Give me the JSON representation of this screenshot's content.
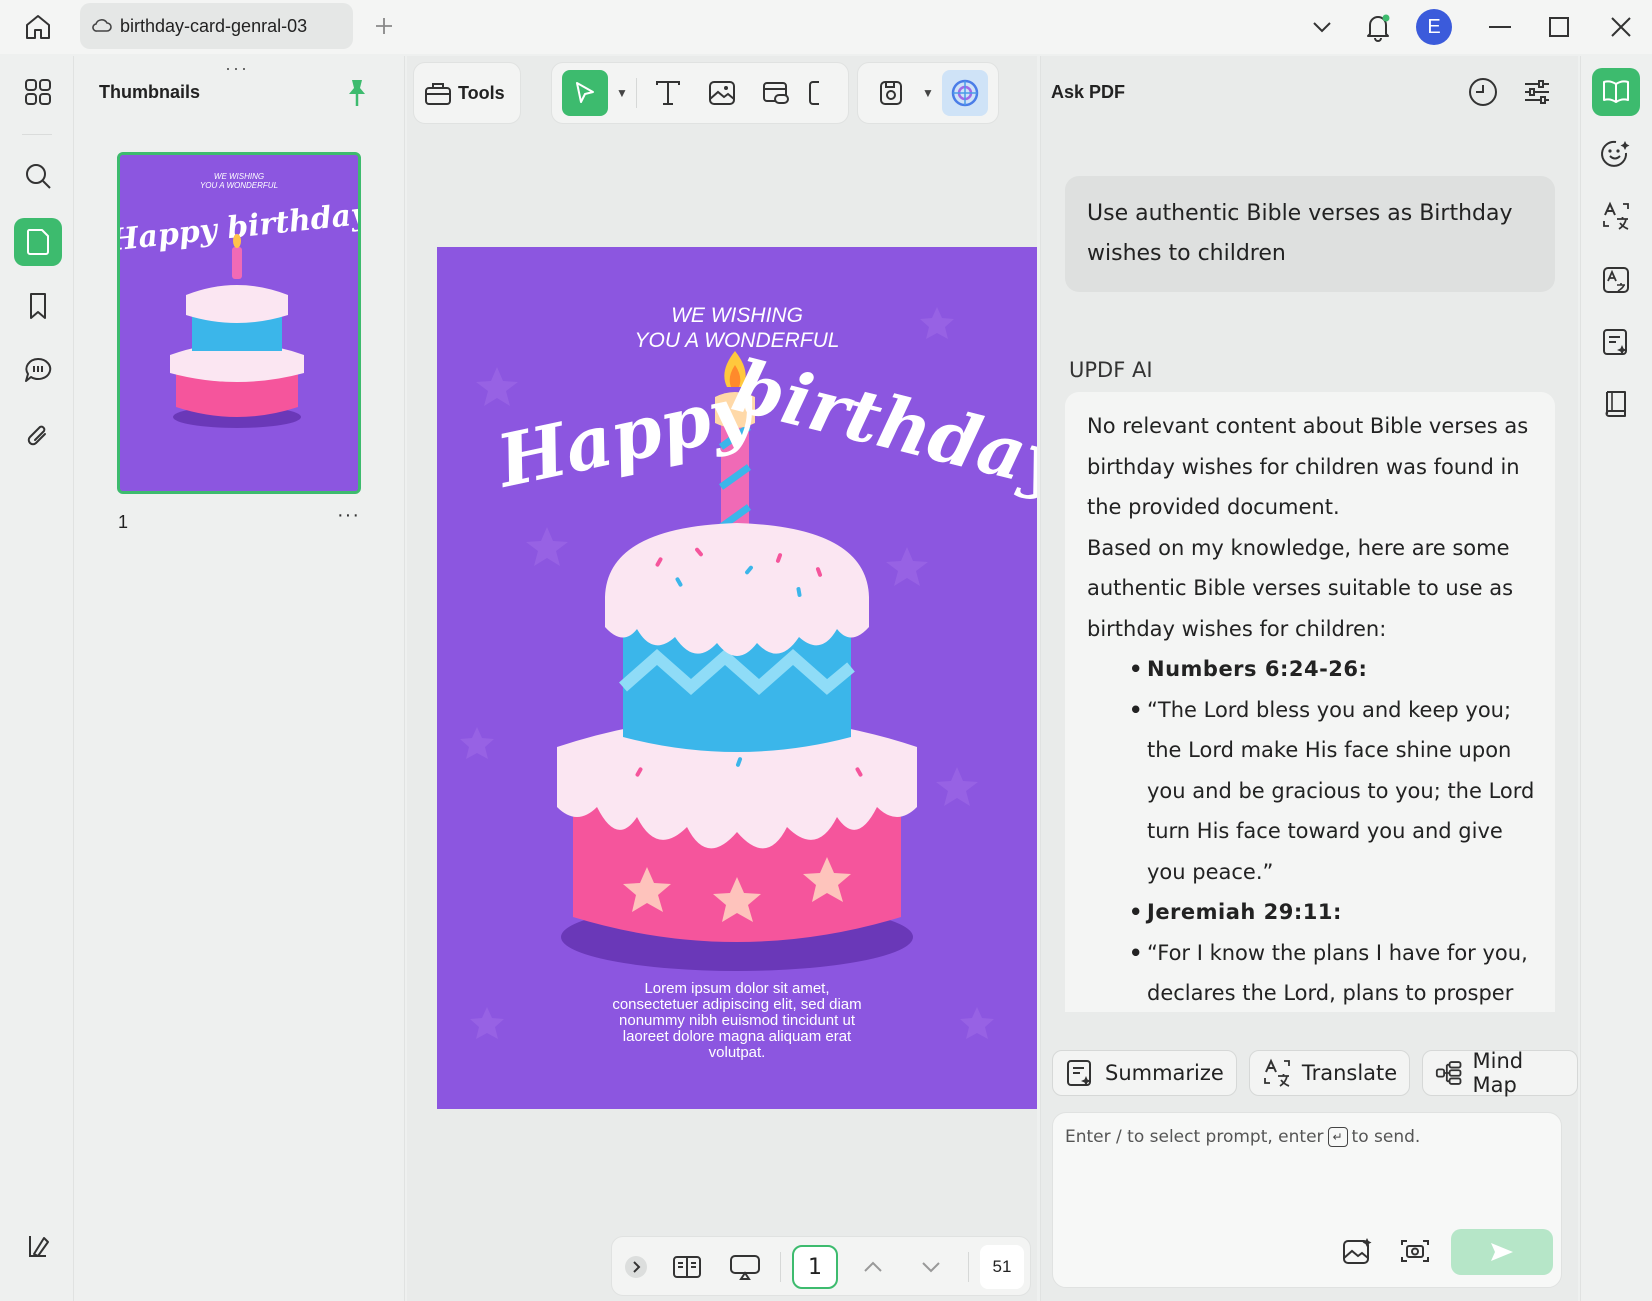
{
  "titlebar": {
    "tab_title": "birthday-card-genral-03",
    "avatar_letter": "E"
  },
  "thumbnails": {
    "title": "Thumbnails",
    "page_number": "1",
    "more_label": "···"
  },
  "toolbar": {
    "tools_label": "Tools"
  },
  "document": {
    "wish_line1": "WE WISHING",
    "wish_line2": "YOU A WONDERFUL",
    "headline_word1": "Happy",
    "headline_word2": "birthday",
    "lorem": [
      "Lorem ipsum dolor sit amet,",
      "consectetuer adipiscing elit, sed diam",
      "nonummy nibh euismod tincidunt ut",
      "laoreet dolore magna aliquam erat",
      "volutpat."
    ],
    "background_color": "#8c56e0"
  },
  "navigation": {
    "current_page": "1",
    "zoom": "51"
  },
  "ask_pdf": {
    "title": "Ask PDF",
    "user_message": "Use authentic Bible verses as Birthday wishes to children",
    "ai_label": "UPDF AI",
    "ai_intro_1": "No relevant content about Bible verses as birthday wishes for children was found in the provided document.",
    "ai_intro_2": "Based on my knowledge, here are some authentic Bible verses suitable to use as birthday wishes for children:",
    "items": [
      {
        "text": "Numbers 6:24-26:",
        "bold": true
      },
      {
        "text": "“The Lord bless you and keep you; the Lord make His face shine upon you and be gracious to you; the Lord turn His face toward you and give you peace.”",
        "bold": false
      },
      {
        "text": "Jeremiah 29:11:",
        "bold": true
      },
      {
        "text": "“For I know the plans I have for you, declares the Lord, plans to prosper",
        "bold": false
      }
    ],
    "actions": {
      "summarize": "Summarize",
      "translate": "Translate",
      "mind_map": "Mind Map"
    },
    "prompt_placeholder_a": "Enter / to select prompt, enter",
    "prompt_placeholder_b": "to send."
  },
  "colors": {
    "accent": "#3dbb6e",
    "avatar": "#3b5bdb",
    "card_purple": "#8c56e0"
  }
}
